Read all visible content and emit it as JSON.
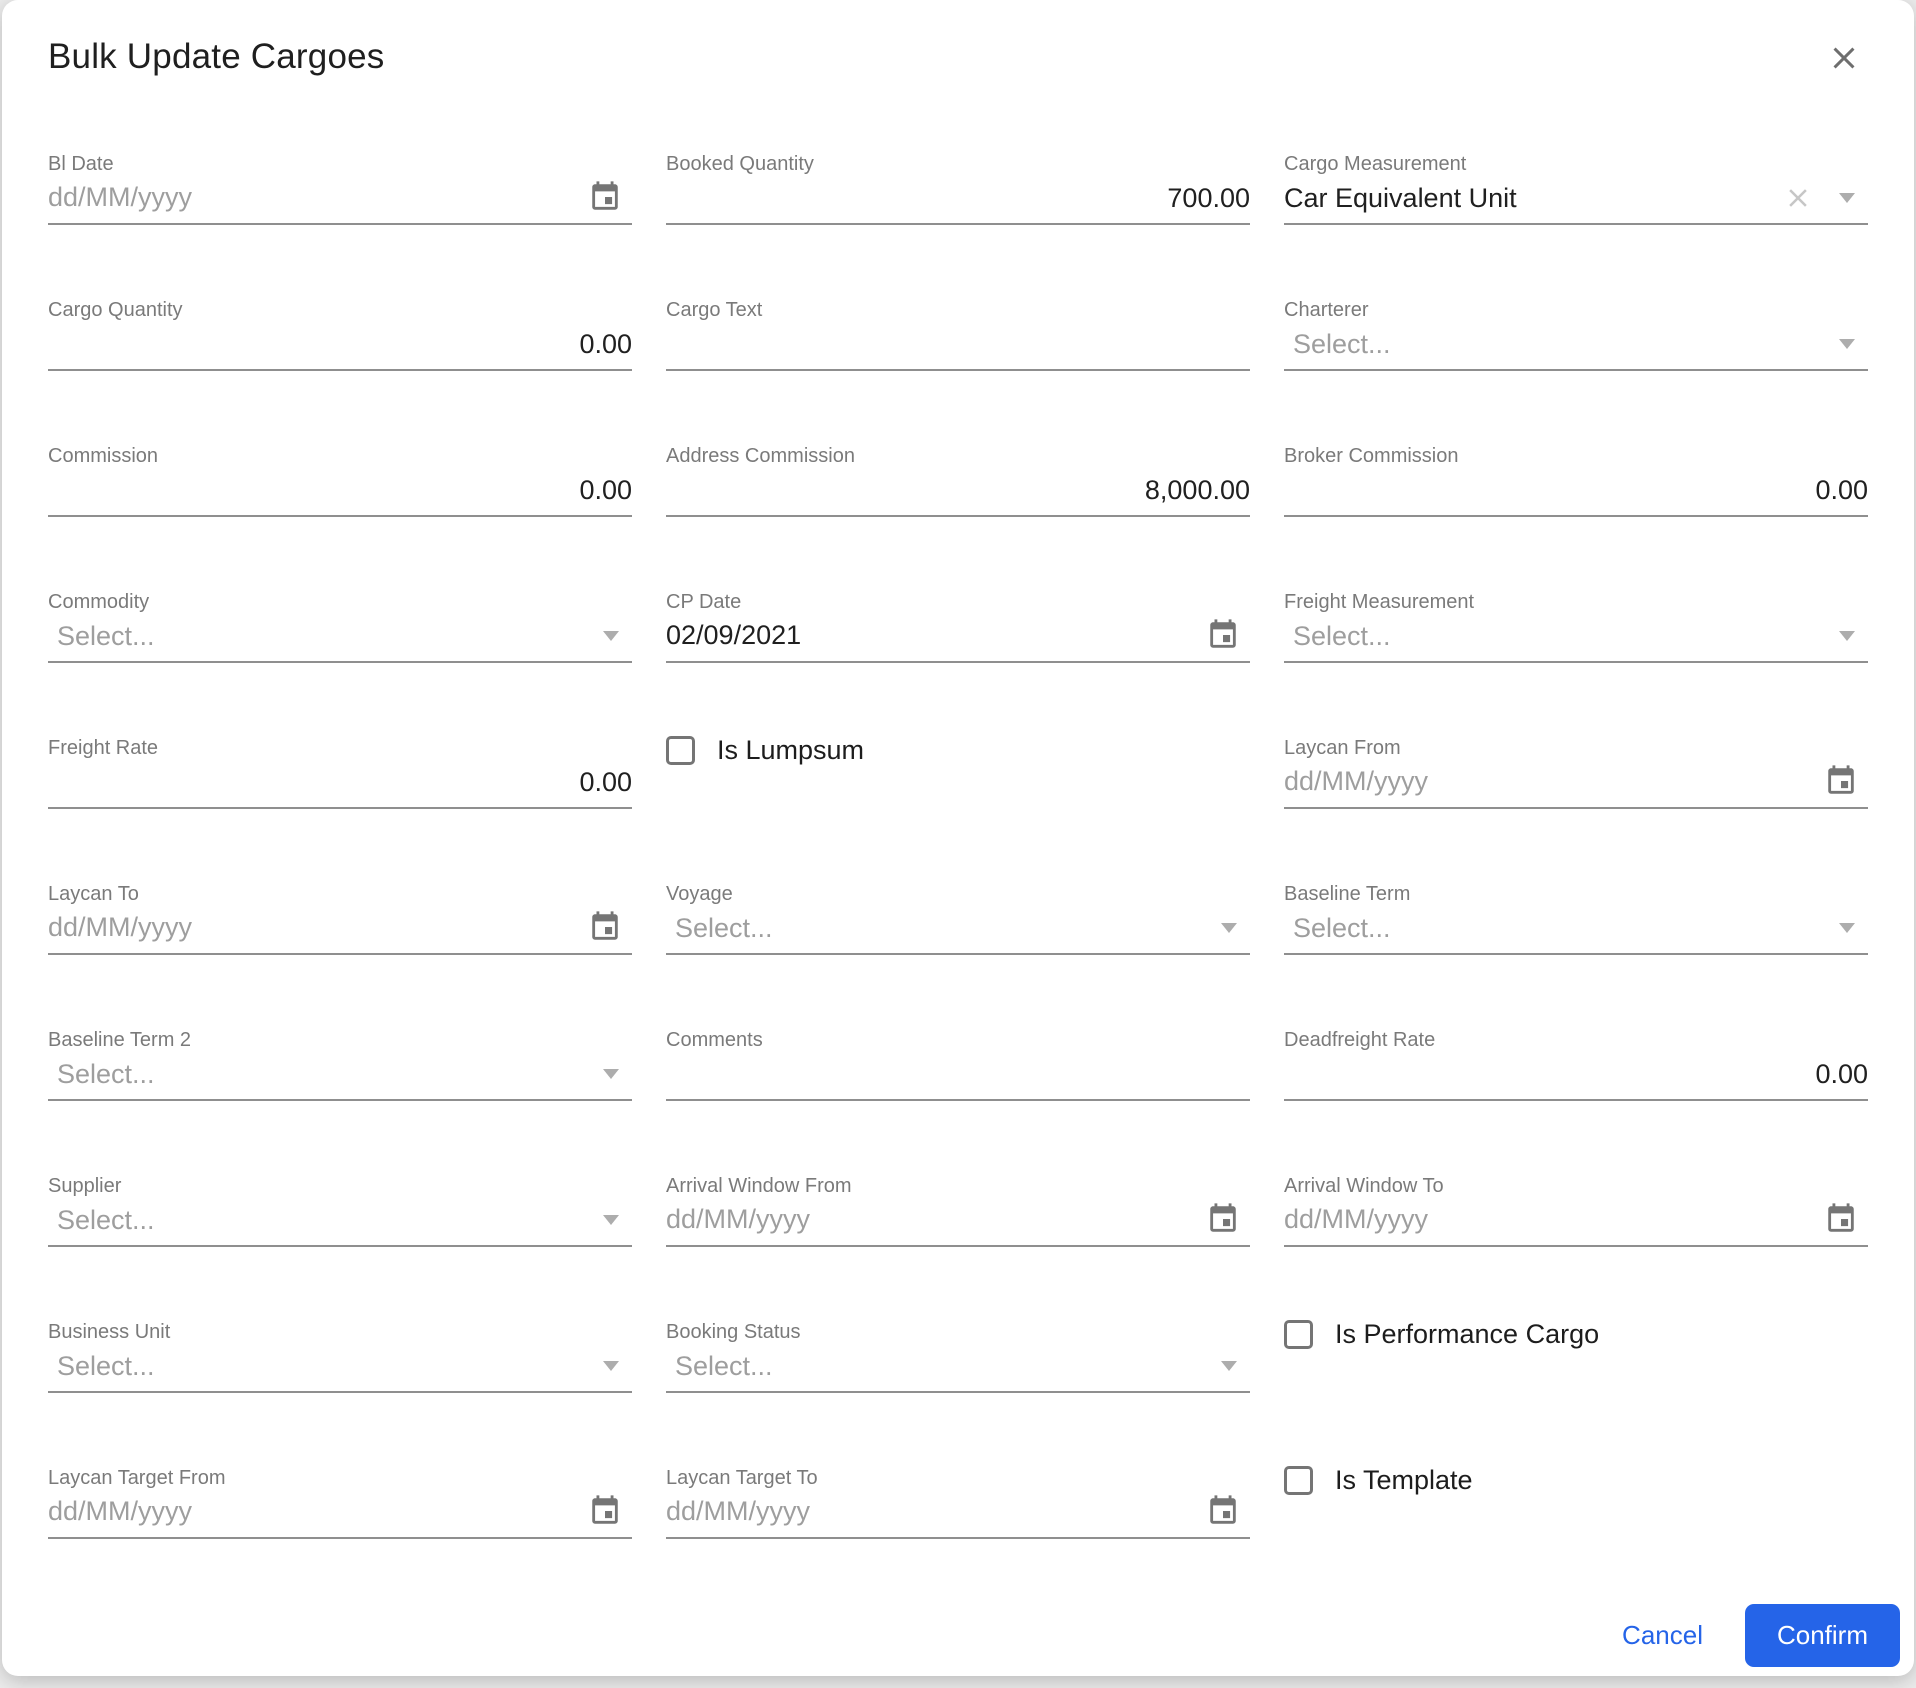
{
  "dialog": {
    "title": "Bulk Update Cargoes",
    "colors": {
      "accent": "#2564e8",
      "underline": "#8f8f8f",
      "label": "#7a7a7a",
      "placeholder": "#9e9e9e"
    },
    "fields": [
      {
        "label": "Bl Date",
        "type": "date",
        "placeholder": "dd/MM/yyyy",
        "icon": "calendar-icon"
      },
      {
        "label": "Booked Quantity",
        "type": "number",
        "value": "700.00"
      },
      {
        "label": "Cargo Measurement",
        "type": "select",
        "value": "Car Equivalent Unit",
        "clearable": true,
        "icon": "dropdown-arrow-icon",
        "clear_icon": "clear-icon"
      },
      {
        "label": "Cargo Quantity",
        "type": "number",
        "value": "0.00"
      },
      {
        "label": "Cargo Text",
        "type": "text",
        "value": ""
      },
      {
        "label": "Charterer",
        "type": "select",
        "placeholder": "Select...",
        "icon": "dropdown-arrow-icon"
      },
      {
        "label": "Commission",
        "type": "number",
        "value": "0.00"
      },
      {
        "label": "Address Commission",
        "type": "number",
        "value": "8,000.00"
      },
      {
        "label": "Broker Commission",
        "type": "number",
        "value": "0.00"
      },
      {
        "label": "Commodity",
        "type": "select",
        "placeholder": "Select...",
        "icon": "dropdown-arrow-icon"
      },
      {
        "label": "CP Date",
        "type": "date",
        "value": "02/09/2021",
        "icon": "calendar-icon"
      },
      {
        "label": "Freight Measurement",
        "type": "select",
        "placeholder": "Select...",
        "icon": "dropdown-arrow-icon"
      },
      {
        "label": "Freight Rate",
        "type": "number",
        "value": "0.00"
      },
      {
        "label": "Is Lumpsum",
        "type": "checkbox",
        "checked": false
      },
      {
        "label": "Laycan From",
        "type": "date",
        "placeholder": "dd/MM/yyyy",
        "icon": "calendar-icon"
      },
      {
        "label": "Laycan To",
        "type": "date",
        "placeholder": "dd/MM/yyyy",
        "icon": "calendar-icon"
      },
      {
        "label": "Voyage",
        "type": "select",
        "placeholder": "Select...",
        "icon": "dropdown-arrow-icon"
      },
      {
        "label": "Baseline Term",
        "type": "select",
        "placeholder": "Select...",
        "icon": "dropdown-arrow-icon"
      },
      {
        "label": "Baseline Term 2",
        "type": "select",
        "placeholder": "Select...",
        "icon": "dropdown-arrow-icon"
      },
      {
        "label": "Comments",
        "type": "text",
        "value": ""
      },
      {
        "label": "Deadfreight Rate",
        "type": "number",
        "value": "0.00"
      },
      {
        "label": "Supplier",
        "type": "select",
        "placeholder": "Select...",
        "icon": "dropdown-arrow-icon"
      },
      {
        "label": "Arrival Window From",
        "type": "date",
        "placeholder": "dd/MM/yyyy",
        "icon": "calendar-icon"
      },
      {
        "label": "Arrival Window To",
        "type": "date",
        "placeholder": "dd/MM/yyyy",
        "icon": "calendar-icon"
      },
      {
        "label": "Business Unit",
        "type": "select",
        "placeholder": "Select...",
        "icon": "dropdown-arrow-icon"
      },
      {
        "label": "Booking Status",
        "type": "select",
        "placeholder": "Select...",
        "icon": "dropdown-arrow-icon"
      },
      {
        "label": "Is Performance Cargo",
        "type": "checkbox",
        "checked": false
      },
      {
        "label": "Laycan Target From",
        "type": "date",
        "placeholder": "dd/MM/yyyy",
        "icon": "calendar-icon"
      },
      {
        "label": "Laycan Target To",
        "type": "date",
        "placeholder": "dd/MM/yyyy",
        "icon": "calendar-icon"
      },
      {
        "label": "Is Template",
        "type": "checkbox",
        "checked": false
      }
    ],
    "footer": {
      "cancel_label": "Cancel",
      "confirm_label": "Confirm"
    }
  }
}
